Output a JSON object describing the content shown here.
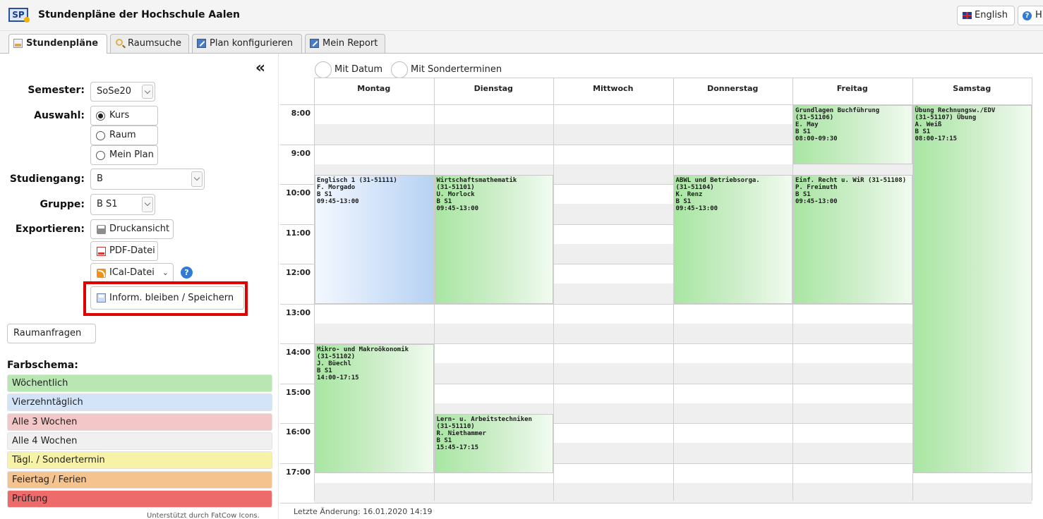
{
  "app": {
    "logo_text": "SP",
    "title": "Stundenpläne der Hochschule Aalen"
  },
  "header": {
    "english_label": "English",
    "help_label": "Hi"
  },
  "tabs": [
    {
      "label": "Stundenpläne",
      "icon": "calendar-icon",
      "active": true
    },
    {
      "label": "Raumsuche",
      "icon": "search-icon",
      "active": false
    },
    {
      "label": "Plan konfigurieren",
      "icon": "edit-icon",
      "active": false
    },
    {
      "label": "Mein Report",
      "icon": "edit-icon",
      "active": false
    }
  ],
  "sidebar": {
    "collapse_symbol": "«",
    "semester": {
      "label": "Semester:",
      "value": "SoSe20"
    },
    "auswahl": {
      "label": "Auswahl:",
      "options": [
        "Kurs",
        "Raum",
        "Mein Plan"
      ],
      "selected": "Kurs"
    },
    "studiengang": {
      "label": "Studiengang:",
      "value": "B"
    },
    "gruppe": {
      "label": "Gruppe:",
      "value": "B S1"
    },
    "export": {
      "label": "Exportieren:",
      "print_label": "Druckansicht",
      "pdf_label": "PDF-Datei",
      "ical_label": "ICal-Datei",
      "help_symbol": "?",
      "save_label": "Inform. bleiben / Speichern"
    },
    "raumanfragen_label": "Raumanfragen",
    "farbschema": {
      "title": "Farbschema:",
      "items": [
        {
          "label": "Wöchentlich",
          "color": "#b9e7b3"
        },
        {
          "label": "Vierzehntäglich",
          "color": "#d3e4f8"
        },
        {
          "label": "Alle 3 Wochen",
          "color": "#f3c7c7"
        },
        {
          "label": "Alle 4 Wochen",
          "color": "#f0f0f0"
        },
        {
          "label": "Tägl. / Sondertermin",
          "color": "#f7f3a6"
        },
        {
          "label": "Feiertag / Ferien",
          "color": "#f4c38e"
        },
        {
          "label": "Prüfung",
          "color": "#ee6b6b"
        }
      ]
    },
    "powered_by": "Unterstützt durch FatCow Icons."
  },
  "timetable": {
    "options": {
      "mit_datum": "Mit Datum",
      "mit_sonderterminen": "Mit Sonderterminen"
    },
    "days": [
      "Montag",
      "Dienstag",
      "Mittwoch",
      "Donnerstag",
      "Freitag",
      "Samstag"
    ],
    "hours": [
      "8:00",
      "9:00",
      "10:00",
      "11:00",
      "12:00",
      "13:00",
      "14:00",
      "15:00",
      "16:00",
      "17:00"
    ],
    "events": [
      {
        "day": 0,
        "start": "09:45",
        "end": "13:00",
        "color": "blue",
        "text": "Englisch 1 (31-51111)\nF. Morgado\nB S1\n09:45-13:00"
      },
      {
        "day": 1,
        "start": "09:45",
        "end": "13:00",
        "color": "green",
        "text": "Wirtschaftsmathematik\n(31-51101)\nU. Morlock\nB S1\n09:45-13:00"
      },
      {
        "day": 3,
        "start": "09:45",
        "end": "13:00",
        "color": "green",
        "text": "ABWL und Betriebsorga.\n(31-51104)\nK. Renz\nB S1\n09:45-13:00"
      },
      {
        "day": 4,
        "start": "08:00",
        "end": "09:30",
        "color": "green",
        "text": "Grundlagen Buchführung\n(31-51106)\nE. May\nB S1\n08:00-09:30"
      },
      {
        "day": 4,
        "start": "09:45",
        "end": "13:00",
        "color": "green",
        "text": "Einf. Recht u. WiR (31-51108)\nP. Freimuth\nB S1\n09:45-13:00"
      },
      {
        "day": 5,
        "start": "08:00",
        "end": "17:15",
        "color": "green",
        "text": "Übung Rechnungsw./EDV\n(31-51107) Übung\nA. Weiß\nB S1\n08:00-17:15"
      },
      {
        "day": 0,
        "start": "14:00",
        "end": "17:15",
        "color": "green",
        "text": "Mikro- und Makroökonomik\n(31-51102)\nJ. Büechl\nB S1\n14:00-17:15"
      },
      {
        "day": 1,
        "start": "15:45",
        "end": "17:15",
        "color": "green",
        "text": "Lern- u. Arbeitstechniken\n(31-51110)\nR. Niethammer\nB S1\n15:45-17:15"
      }
    ],
    "last_change": "Letzte Änderung: 16.01.2020 14:19"
  }
}
